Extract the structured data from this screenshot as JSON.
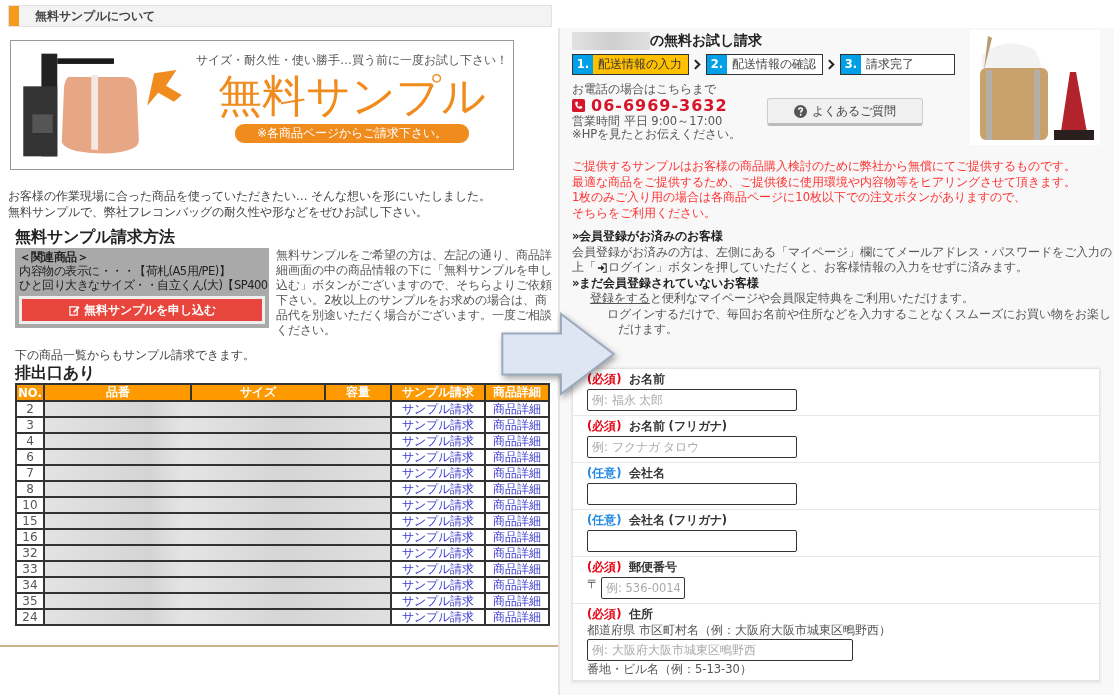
{
  "left_page": {
    "section_title": "無料サンプルについて",
    "banner": {
      "kind": "picture",
      "tagline": "サイズ・耐久性・使い勝手…買う前に一度お試し下さい！",
      "headline": "無料サンプル",
      "note": "※各商品ページからご請求下さい。"
    },
    "intro": [
      "お客様の作業現場に合った商品を使っていただきたい… そんな想いを形にいたしました。",
      "無料サンプルで、弊社フレコンバッグの耐久性や形などをぜひお試し下さい。"
    ],
    "method_heading": "無料サンプル請求方法",
    "method_example": {
      "lines": [
        "＜関連商品＞",
        "内容物の表示に・・・【荷札(A5用/PE)】",
        "ひと回り大きなサイズ・・自立くん(大)【SP400"
      ],
      "button": "無料サンプルを申し込む"
    },
    "method_text": "無料サンプルをご希望の方は、左記の通り、商品詳細画面の中の商品情報の下に「無料サンプルを申し込む」ボタンがございますので、そちらよりご依頼下さい。2枚以上のサンプルをお求めの場合は、商品代を別途いただく場合がございます。一度ご相談ください。",
    "list_note": "下の商品一覧からもサンプル請求できます。",
    "table_heading": "排出口あり",
    "table": {
      "columns": [
        "NO.",
        "品番",
        "サイズ",
        "容量",
        "サンプル請求",
        "商品詳細"
      ],
      "rows": [
        {
          "no": "2",
          "request": "サンプル請求",
          "detail": "商品詳細"
        },
        {
          "no": "3",
          "request": "サンプル請求",
          "detail": "商品詳細"
        },
        {
          "no": "4",
          "request": "サンプル請求",
          "detail": "商品詳細"
        },
        {
          "no": "6",
          "request": "サンプル請求",
          "detail": "商品詳細"
        },
        {
          "no": "7",
          "request": "サンプル請求",
          "detail": "商品詳細"
        },
        {
          "no": "8",
          "request": "サンプル請求",
          "detail": "商品詳細"
        },
        {
          "no": "10",
          "request": "サンプル請求",
          "detail": "商品詳細"
        },
        {
          "no": "15",
          "request": "サンプル請求",
          "detail": "商品詳細"
        },
        {
          "no": "16",
          "request": "サンプル請求",
          "detail": "商品詳細"
        },
        {
          "no": "32",
          "request": "サンプル請求",
          "detail": "商品詳細"
        },
        {
          "no": "33",
          "request": "サンプル請求",
          "detail": "商品詳細"
        },
        {
          "no": "34",
          "request": "サンプル請求",
          "detail": "商品詳細"
        },
        {
          "no": "35",
          "request": "サンプル請求",
          "detail": "商品詳細"
        },
        {
          "no": "24",
          "request": "サンプル請求",
          "detail": "商品詳細"
        }
      ]
    }
  },
  "right_page": {
    "title": "の無料お試し請求",
    "steps": [
      {
        "number": "1.",
        "label": "配送情報の入力",
        "selected": true
      },
      {
        "number": "2.",
        "label": "配送情報の確認",
        "selected": false
      },
      {
        "number": "3.",
        "label": "請求完了",
        "selected": false
      }
    ],
    "phone_label": "お電話の場合はこちらまで",
    "phone": "06-6969-3632",
    "hours": "営業時間 平日 9:00～17:00",
    "hp_note": "※HPを見たとお伝えください。",
    "faq_button": "よくあるご質問",
    "product_image": {
      "kind": "picture"
    },
    "notices": [
      "ご提供するサンプルはお客様の商品購入検討のために弊社から無償にてご提供するものです。",
      "最適な商品をご提供するため、ご提供後に使用環境や内容物等をヒアリングさせて頂きます。",
      "1枚のみご入り用の場合は各商品ページに10枚以下での注文ボタンがありますので、",
      "そちらをご利用ください。"
    ],
    "members_heading": "»会員登録がお済みのお客様",
    "members_text": [
      "会員登録がお済みの方は、左側にある「マイページ」欄にてメールアドレス・パスワードをご入力の",
      "上「",
      "ログイン」ボタンを押していただくと、お客様情報の入力をせずに済みます。"
    ],
    "guests_heading": "»まだ会員登録されていないお客様",
    "guests_link": "登録をする",
    "guests_text": [
      "と便利なマイページや会員限定特典をご利用いただけます。",
      "ログインするだけで、毎回お名前や住所などを入力することなくスムーズにお買い物をお楽し",
      "だけます。"
    ],
    "form": [
      {
        "kind": "required",
        "tag": "(必須)",
        "label": "お名前",
        "placeholder": "例: 福永 太郎"
      },
      {
        "kind": "required",
        "tag": "(必須)",
        "label": "お名前 (フリガナ)",
        "placeholder": "例: フクナガ タロウ"
      },
      {
        "kind": "optional",
        "tag": "(任意)",
        "label": "会社名"
      },
      {
        "kind": "optional",
        "tag": "(任意)",
        "label": "会社名 (フリガナ)"
      },
      {
        "kind": "required",
        "tag": "(必須)",
        "label": "郵便番号",
        "prefix": "〒",
        "placeholder": "例: 536-0014"
      },
      {
        "kind": "required",
        "tag": "(必須)",
        "label": "住所",
        "hint": "都道府県 市区町村名（例：大阪府大阪市城東区鴫野西）",
        "placeholder": "例: 大阪府大阪市城東区鴫野西",
        "hint2": "番地・ビル名（例：5-13-30）"
      }
    ]
  }
}
